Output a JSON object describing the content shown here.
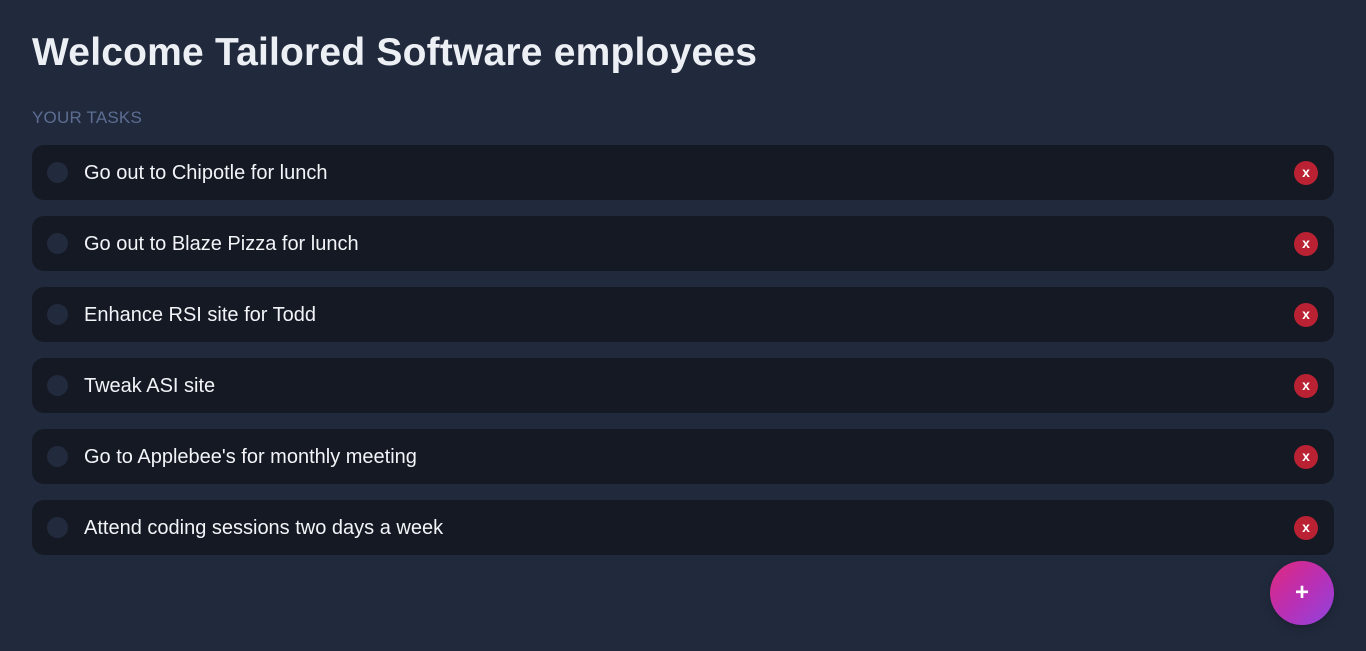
{
  "header": {
    "title": "Welcome Tailored Software employees"
  },
  "tasks_section": {
    "label": "YOUR TASKS",
    "delete_label": "x",
    "items": [
      {
        "text": "Go out to Chipotle for lunch",
        "completed": false
      },
      {
        "text": "Go out to Blaze Pizza for lunch",
        "completed": false
      },
      {
        "text": "Enhance RSI site for Todd",
        "completed": false
      },
      {
        "text": "Tweak ASI site",
        "completed": false
      },
      {
        "text": "Go to Applebee's for monthly meeting",
        "completed": false
      },
      {
        "text": "Attend coding sessions two days a week",
        "completed": false
      }
    ]
  },
  "fab": {
    "label": "+"
  },
  "icons": {
    "task_checkbox": "circle-checkbox-icon",
    "delete": "close-icon",
    "add": "plus-icon"
  },
  "colors": {
    "background": "#212a3d",
    "card": "#141923",
    "delete": "#ba2233",
    "fab_gradient_start": "#e0287d",
    "fab_gradient_end": "#8e44de"
  }
}
